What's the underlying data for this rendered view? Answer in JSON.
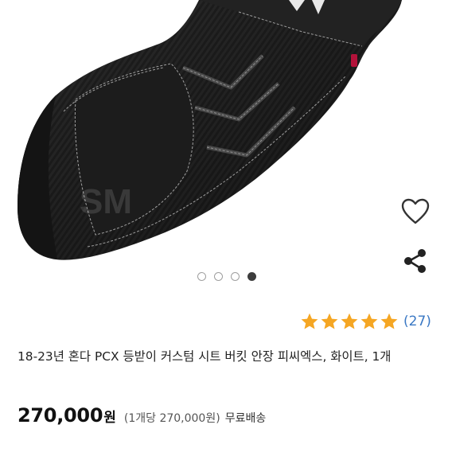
{
  "product": {
    "title": "18-23년 혼다 PCX 등받이 커스텀 시트 버킷 안장 피씨엑스, 화이트, 1개",
    "watermark": "SM",
    "image_count": 4,
    "active_image_index": 3,
    "rating": {
      "stars": 5,
      "max_stars": 5,
      "review_count": "(27)",
      "star_color": "#f5a623"
    },
    "price": {
      "amount": "270,000",
      "currency": "원",
      "unit_price": "(1개당 270,000원)",
      "shipping": "무료배송"
    },
    "icons": {
      "favorite": "heart-outline-icon",
      "share": "share-icon"
    }
  }
}
